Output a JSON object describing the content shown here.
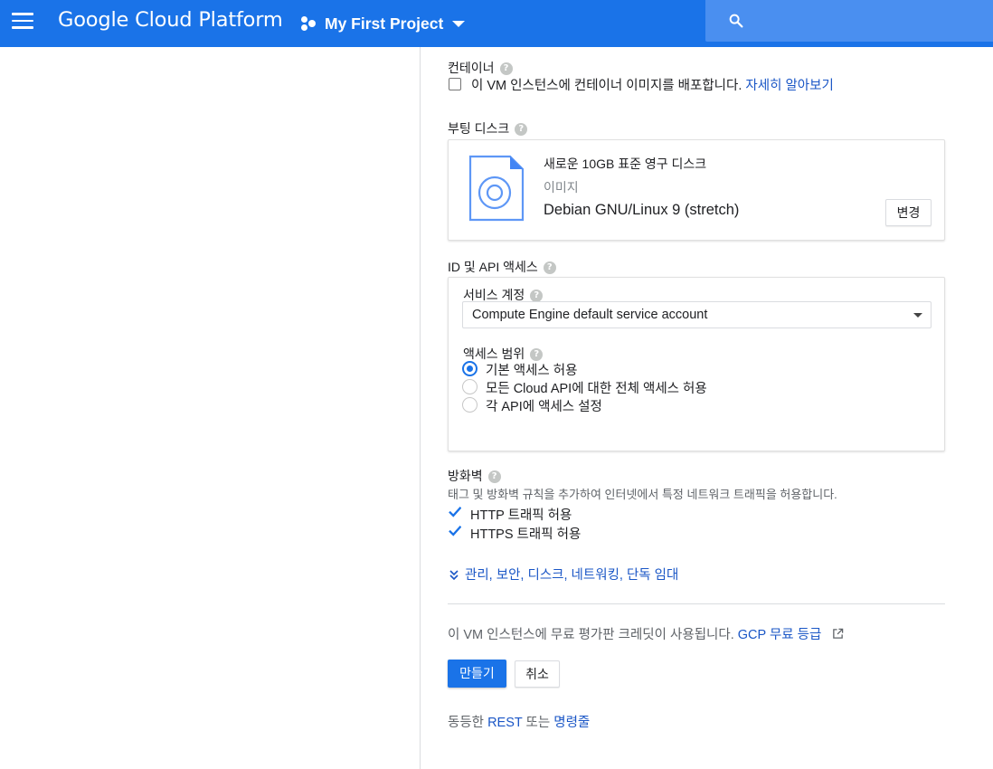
{
  "header": {
    "brand": "Google Cloud Platform",
    "project": "My First Project",
    "menu_icon": "hamburger-menu-icon",
    "project_icon": "project-hub-icon",
    "search_icon": "search-icon",
    "accent_color": "#1a73e8"
  },
  "container": {
    "title": "컨테이너",
    "checkbox_text": "이 VM 인스턴스에 컨테이너 이미지를 배포합니다.",
    "learn_more": "자세히 알아보기",
    "checked": false
  },
  "boot_disk": {
    "title": "부팅 디스크",
    "line1": "새로운 10GB 표준 영구 디스크",
    "line2": "이미지",
    "line3": "Debian GNU/Linux 9 (stretch)",
    "change_button": "변경",
    "disk_icon": "disk-image-icon"
  },
  "identity": {
    "title": "ID 및 API 액세스",
    "service_account_label": "서비스 계정",
    "service_account_value": "Compute Engine default service account",
    "scope_label": "액세스 범위",
    "scope_options": [
      {
        "label": "기본 액세스 허용",
        "selected": true
      },
      {
        "label": "모든 Cloud API에 대한 전체 액세스 허용",
        "selected": false
      },
      {
        "label": "각 API에 액세스 설정",
        "selected": false
      }
    ]
  },
  "firewall": {
    "title": "방화벽",
    "description": "태그 및 방화벽 규칙을 추가하여 인터넷에서 특정 네트워크 트래픽을 허용합니다.",
    "http": {
      "label": "HTTP 트래픽 허용",
      "checked": true
    },
    "https": {
      "label": "HTTPS 트래픽 허용",
      "checked": true
    }
  },
  "advanced_link": "관리, 보안, 디스크, 네트워킹, 단독 임대",
  "credit": {
    "text": "이 VM 인스턴스에 무료 평가판 크레딧이 사용됩니다.",
    "link": "GCP 무료 등급",
    "icon": "open-in-new-icon"
  },
  "actions": {
    "create": "만들기",
    "cancel": "취소"
  },
  "equivalent": {
    "prefix": "동등한",
    "rest": "REST",
    "middle": "또는",
    "command_line": "명령줄"
  }
}
